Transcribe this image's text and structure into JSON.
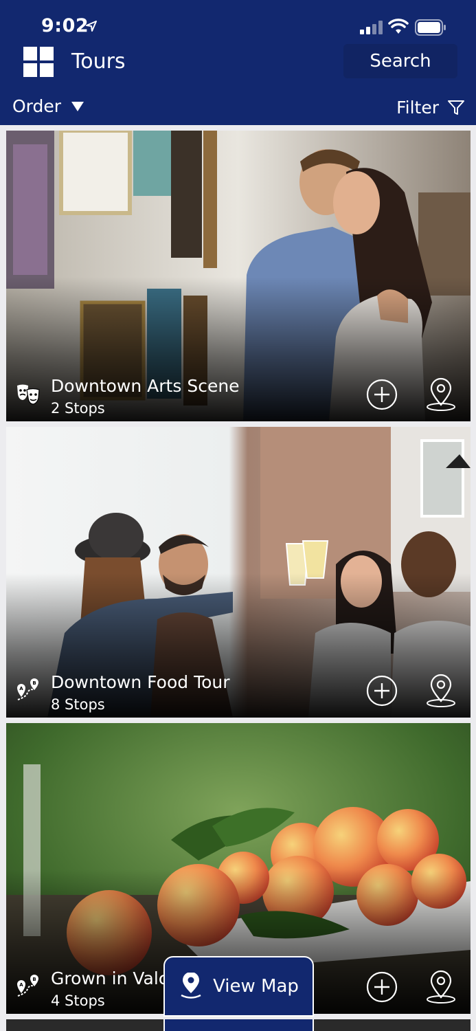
{
  "status_bar": {
    "time": "9:02"
  },
  "header": {
    "title": "Tours",
    "search_label": "Search"
  },
  "toolbar": {
    "order_label": "Order",
    "filter_label": "Filter"
  },
  "tours": [
    {
      "name": "Downtown Arts Scene",
      "stops": "2 Stops",
      "category_icon": "theater-masks-icon"
    },
    {
      "name": "Downtown Food Tour",
      "stops": "8 Stops",
      "category_icon": "route-a-b-icon"
    },
    {
      "name": "Grown in Valc",
      "stops": "4 Stops",
      "category_icon": "route-a-b-icon"
    }
  ],
  "view_map_label": "View Map",
  "colors": {
    "brand_navy": "#12286f",
    "button_navy": "#112463",
    "background": "#ececef"
  }
}
